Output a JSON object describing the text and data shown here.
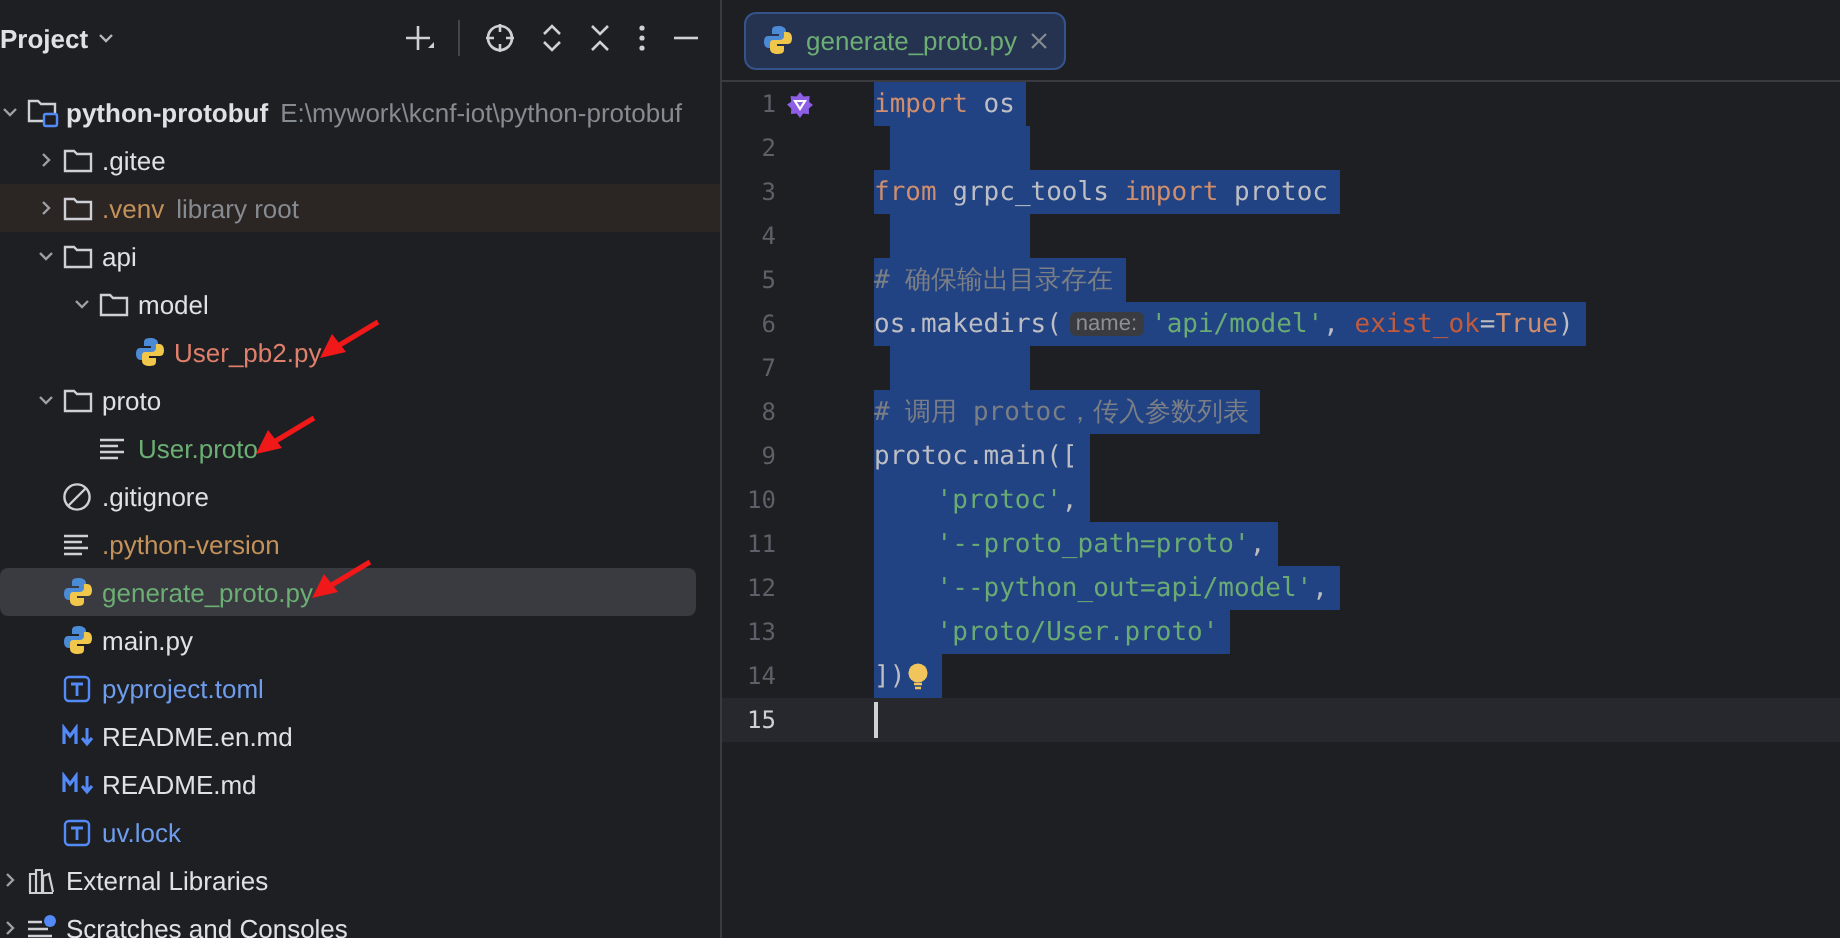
{
  "project_panel": {
    "title": "Project",
    "tree": [
      {
        "name": "python-protobuf",
        "hint": "E:\\mywork\\kcnf-iot\\python-protobuf",
        "kind": "module",
        "color": "#dfe1e5",
        "expanded": true,
        "selected": false,
        "marked": false,
        "children": [
          {
            "name": ".gitee",
            "kind": "folder",
            "color": "#dfe1e5",
            "expanded": false,
            "selected": false,
            "marked": false
          },
          {
            "name": ".venv",
            "hint": "library root",
            "kind": "folder",
            "color": "#c3915a",
            "expanded": false,
            "selected": false,
            "marked": false
          },
          {
            "name": "api",
            "kind": "folder",
            "color": "#dfe1e5",
            "expanded": true,
            "selected": false,
            "marked": false,
            "children": [
              {
                "name": "model",
                "kind": "folder",
                "color": "#dfe1e5",
                "expanded": true,
                "selected": false,
                "marked": false,
                "children": [
                  {
                    "name": "User_pb2.py",
                    "kind": "python",
                    "color": "#e0806c",
                    "selected": false,
                    "marked": true
                  }
                ]
              }
            ]
          },
          {
            "name": "proto",
            "kind": "folder",
            "color": "#dfe1e5",
            "expanded": true,
            "selected": false,
            "marked": false,
            "children": [
              {
                "name": "User.proto",
                "kind": "text",
                "color": "#6cae74",
                "selected": false,
                "marked": true
              }
            ]
          },
          {
            "name": ".gitignore",
            "kind": "ignore",
            "color": "#dfe1e5",
            "selected": false,
            "marked": false
          },
          {
            "name": ".python-version",
            "kind": "text",
            "color": "#c3915a",
            "selected": false,
            "marked": false
          },
          {
            "name": "generate_proto.py",
            "kind": "python",
            "color": "#6cae74",
            "selected": true,
            "marked": true
          },
          {
            "name": "main.py",
            "kind": "python",
            "color": "#dfe1e5",
            "selected": false,
            "marked": false
          },
          {
            "name": "pyproject.toml",
            "kind": "toml",
            "color": "#6f9ded",
            "selected": false,
            "marked": false
          },
          {
            "name": "README.en.md",
            "kind": "markdown",
            "color": "#dfe1e5",
            "selected": false,
            "marked": false
          },
          {
            "name": "README.md",
            "kind": "markdown",
            "color": "#dfe1e5",
            "selected": false,
            "marked": false
          },
          {
            "name": "uv.lock",
            "kind": "toml",
            "color": "#6f9ded",
            "selected": false,
            "marked": false
          }
        ]
      },
      {
        "name": "External Libraries",
        "kind": "libraries",
        "color": "#dfe1e5",
        "expanded": false,
        "selected": false,
        "marked": false
      },
      {
        "name": "Scratches and Consoles",
        "kind": "scratches",
        "color": "#dfe1e5",
        "expanded": false,
        "selected": false,
        "marked": false
      }
    ]
  },
  "editor": {
    "tabs": [
      {
        "label": "generate_proto.py",
        "selected": true
      }
    ],
    "lines": [
      {
        "number": "1",
        "selected": true,
        "current": false,
        "gutter_icon": true,
        "tokens": [
          {
            "kind": "keyword",
            "text": "import"
          },
          {
            "kind": "plain",
            "text": " os"
          }
        ]
      },
      {
        "number": "2",
        "selected": true,
        "current": false
      },
      {
        "number": "3",
        "selected": true,
        "current": false,
        "tokens": [
          {
            "kind": "keyword",
            "text": "from"
          },
          {
            "kind": "plain",
            "text": " grpc_tools "
          },
          {
            "kind": "keyword",
            "text": "import"
          },
          {
            "kind": "plain",
            "text": " protoc"
          }
        ]
      },
      {
        "number": "4",
        "selected": true,
        "current": false
      },
      {
        "number": "5",
        "selected": true,
        "current": false,
        "tokens": [
          {
            "kind": "comment",
            "text": "# 确保输出目录存在"
          }
        ]
      },
      {
        "number": "6",
        "selected": true,
        "current": false,
        "tokens": [
          {
            "kind": "plain",
            "text": "os.makedirs("
          },
          {
            "kind": "hint",
            "text": "name:"
          },
          {
            "kind": "string",
            "text": "'api/model'"
          },
          {
            "kind": "plain",
            "text": ", "
          },
          {
            "kind": "param",
            "text": "exist_ok"
          },
          {
            "kind": "plain",
            "text": "="
          },
          {
            "kind": "keyword",
            "text": "True"
          },
          {
            "kind": "plain",
            "text": ")"
          }
        ]
      },
      {
        "number": "7",
        "selected": true,
        "current": false
      },
      {
        "number": "8",
        "selected": true,
        "current": false,
        "tokens": [
          {
            "kind": "comment",
            "text": "# 调用 protoc，传入参数列表"
          }
        ]
      },
      {
        "number": "9",
        "selected": true,
        "current": false,
        "tokens": [
          {
            "kind": "plain",
            "text": "protoc.main(["
          }
        ]
      },
      {
        "number": "10",
        "selected": true,
        "current": false,
        "indented": true,
        "tokens": [
          {
            "kind": "string",
            "text": "'protoc'"
          },
          {
            "kind": "plain",
            "text": ","
          }
        ]
      },
      {
        "number": "11",
        "selected": true,
        "current": false,
        "indented": true,
        "tokens": [
          {
            "kind": "string",
            "text": "'--proto_path=proto'"
          },
          {
            "kind": "plain",
            "text": ","
          }
        ]
      },
      {
        "number": "12",
        "selected": true,
        "current": false,
        "indented": true,
        "tokens": [
          {
            "kind": "string",
            "text": "'--python_out=api/model'"
          },
          {
            "kind": "plain",
            "text": ","
          }
        ]
      },
      {
        "number": "13",
        "selected": true,
        "current": false,
        "indented": true,
        "tokens": [
          {
            "kind": "string",
            "text": "'proto/User.proto'"
          }
        ]
      },
      {
        "number": "14",
        "selected": true,
        "current": false,
        "bulb": true,
        "tokens": [
          {
            "kind": "plain",
            "text": "])"
          }
        ]
      },
      {
        "number": "15",
        "selected": false,
        "current": true
      }
    ]
  }
}
